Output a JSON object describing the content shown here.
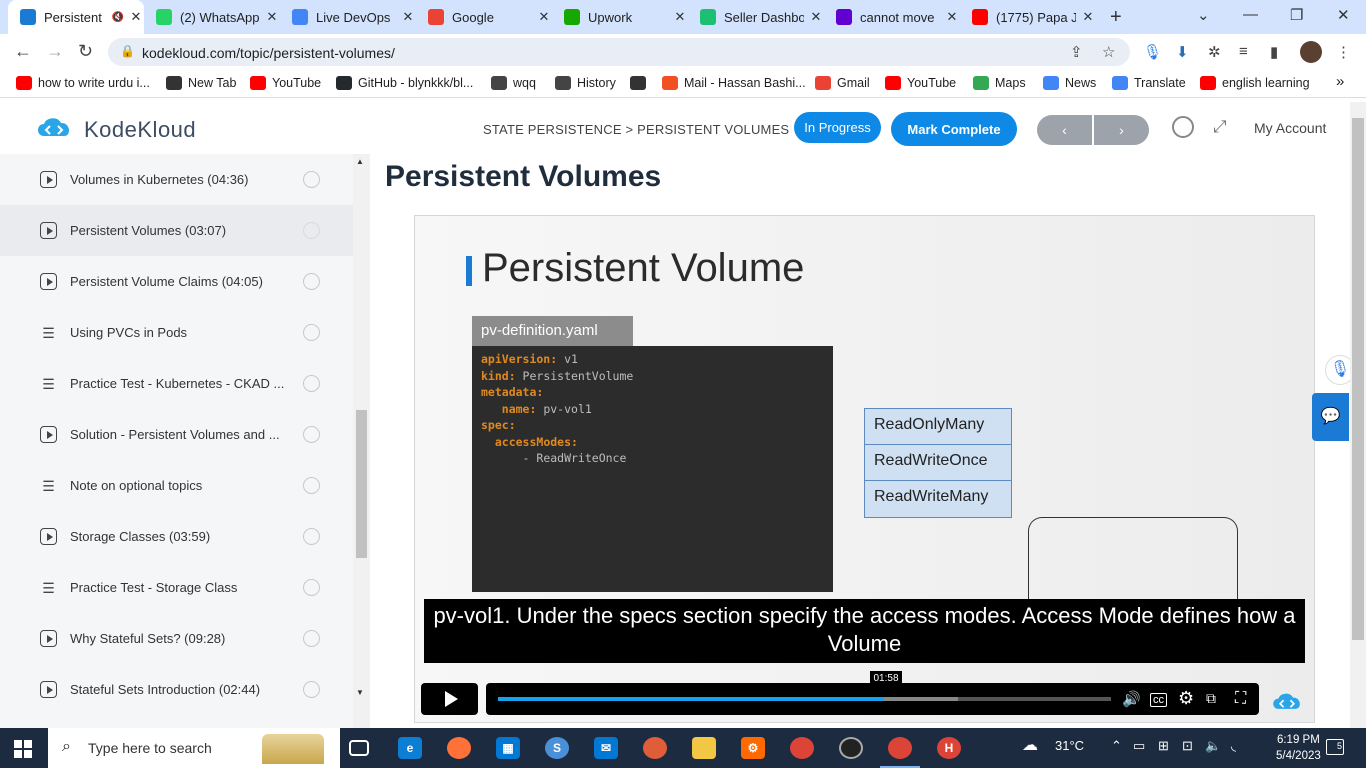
{
  "browser": {
    "tabs": [
      {
        "title": "Persistent",
        "color": "#1a7ad4",
        "icon": "kodekloud-favicon",
        "active": true
      },
      {
        "title": "(2) WhatsApp",
        "color": "#25d366",
        "icon": "whatsapp-favicon"
      },
      {
        "title": "Live DevOps",
        "color": "#4285f4",
        "icon": "google-docs-favicon"
      },
      {
        "title": "Google",
        "color": "#ea4335",
        "icon": "google-favicon"
      },
      {
        "title": "Upwork",
        "color": "#14a800",
        "icon": "upwork-favicon"
      },
      {
        "title": "Seller Dashbo",
        "color": "#1dbf73",
        "icon": "fiverr-favicon"
      },
      {
        "title": "cannot move",
        "color": "#6001d2",
        "icon": "yahoo-favicon"
      },
      {
        "title": "(1775) Papa J",
        "color": "#ff0000",
        "icon": "youtube-favicon"
      }
    ],
    "url": "kodekloud.com/topic/persistent-volumes/",
    "bookmarks": [
      {
        "label": "how to write urdu i...",
        "color": "#ff0000",
        "icon": "youtube-icon"
      },
      {
        "label": "New Tab",
        "color": "#333333",
        "icon": "globe-icon"
      },
      {
        "label": "YouTube",
        "color": "#ff0000",
        "icon": "youtube-icon"
      },
      {
        "label": "GitHub - blynkkk/bl...",
        "color": "#24292e",
        "icon": "github-icon"
      },
      {
        "label": "wqq",
        "color": "#444444",
        "icon": "download-icon"
      },
      {
        "label": "History",
        "color": "#444444",
        "icon": "history-icon"
      },
      {
        "label": "",
        "color": "#333333",
        "icon": "globe-icon"
      },
      {
        "label": "Mail - Hassan Bashi...",
        "color": "#f25022",
        "icon": "microsoft-icon"
      },
      {
        "label": "Gmail",
        "color": "#ea4335",
        "icon": "gmail-icon"
      },
      {
        "label": "YouTube",
        "color": "#ff0000",
        "icon": "youtube-icon"
      },
      {
        "label": "Maps",
        "color": "#34a853",
        "icon": "maps-icon"
      },
      {
        "label": "News",
        "color": "#4285f4",
        "icon": "news-icon"
      },
      {
        "label": "Translate",
        "color": "#4285f4",
        "icon": "translate-icon"
      },
      {
        "label": "english learning",
        "color": "#ff0000",
        "icon": "youtube-icon"
      }
    ],
    "bookmarks_more": "»"
  },
  "header": {
    "logo_text": "KodeKloud",
    "breadcrumb": "STATE PERSISTENCE > PERSISTENT VOLUMES",
    "in_progress_label": "In Progress",
    "mark_complete_label": "Mark Complete",
    "prev_glyph": "‹",
    "next_glyph": "›",
    "account_label": "My Account",
    "accent_color": "#0e8ae6"
  },
  "sidebar": {
    "lessons": [
      {
        "label": "Volumes in Kubernetes (04:36)",
        "type": "video"
      },
      {
        "label": "Persistent Volumes (03:07)",
        "type": "video",
        "current": true
      },
      {
        "label": "Persistent Volume Claims (04:05)",
        "type": "video"
      },
      {
        "label": "Using PVCs in Pods",
        "type": "article"
      },
      {
        "label": "Practice Test - Kubernetes - CKAD ...",
        "type": "article"
      },
      {
        "label": "Solution - Persistent Volumes and ...",
        "type": "video"
      },
      {
        "label": "Note on optional topics",
        "type": "article"
      },
      {
        "label": "Storage Classes (03:59)",
        "type": "video"
      },
      {
        "label": "Practice Test - Storage Class",
        "type": "article"
      },
      {
        "label": "Why Stateful Sets? (09:28)",
        "type": "video"
      },
      {
        "label": "Stateful Sets Introduction (02:44)",
        "type": "video"
      }
    ]
  },
  "main": {
    "page_title": "Persistent Volumes",
    "slide": {
      "title": "Persistent Volume",
      "file_name": "pv-definition.yaml",
      "code_lines": [
        {
          "indent": "",
          "key": "apiVersion:",
          "val": " v1"
        },
        {
          "indent": "",
          "key": "kind:",
          "val": " PersistentVolume"
        },
        {
          "indent": "",
          "key": "metadata:",
          "val": ""
        },
        {
          "indent": "   ",
          "key": "name:",
          "val": " pv-vol1"
        },
        {
          "indent": "",
          "key": "spec:",
          "val": ""
        },
        {
          "indent": "  ",
          "key": "accessModes:",
          "val": ""
        },
        {
          "indent": "      ",
          "key": "",
          "val": "- ReadWriteOnce"
        }
      ],
      "access_modes": [
        "ReadOnlyMany",
        "ReadWriteOnce",
        "ReadWriteMany"
      ]
    },
    "caption": "pv-vol1. Under the specs section specify the access modes. Access Mode defines how a Volume",
    "player": {
      "hover_time": "01:58",
      "progress_fraction": 0.63,
      "buffered_fraction": 0.75
    }
  },
  "taskbar": {
    "search_placeholder": "Type here to search",
    "weather": "31°C",
    "time": "6:19 PM",
    "date": "5/4/2023",
    "notification_count": "5"
  }
}
